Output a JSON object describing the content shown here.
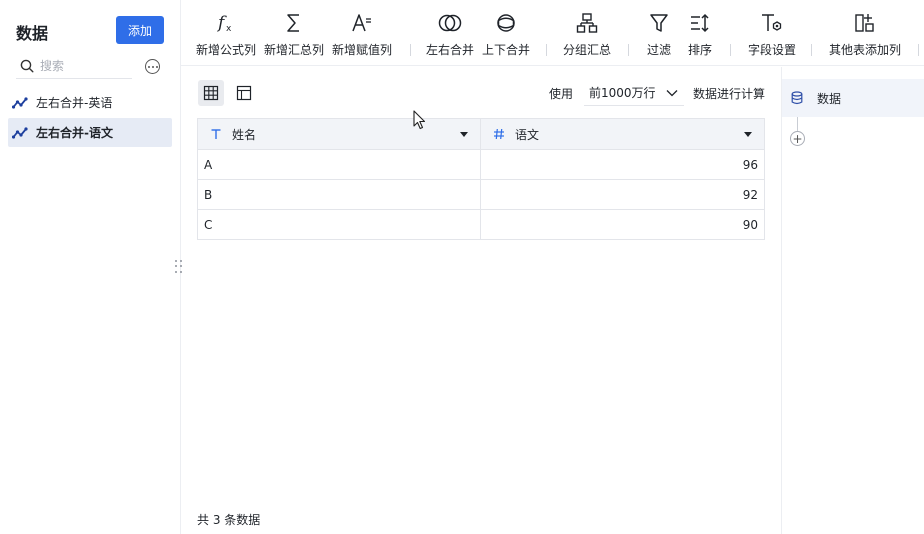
{
  "sidebar": {
    "title": "数据",
    "add_label": "添加",
    "search_placeholder": "搜索",
    "items": [
      {
        "label": "左右合并-英语",
        "active": false
      },
      {
        "label": "左右合并-语文",
        "active": true
      }
    ]
  },
  "toolbar": {
    "buttons": [
      {
        "label": "新增公式列",
        "icon": "formula-icon"
      },
      {
        "label": "新增汇总列",
        "icon": "sigma-icon"
      },
      {
        "label": "新增赋值列",
        "icon": "assign-icon"
      },
      {
        "label": "左右合并",
        "icon": "venn-icon"
      },
      {
        "label": "上下合并",
        "icon": "vertical-merge-icon"
      },
      {
        "label": "分组汇总",
        "icon": "group-icon"
      },
      {
        "label": "过滤",
        "icon": "filter-icon"
      },
      {
        "label": "排序",
        "icon": "sort-icon"
      },
      {
        "label": "字段设置",
        "icon": "field-settings-icon"
      },
      {
        "label": "其他表添加列",
        "icon": "add-column-icon"
      }
    ]
  },
  "controls": {
    "use_label": "使用",
    "rows_value": "前1000万行",
    "calc_label": "数据进行计算"
  },
  "table": {
    "columns": [
      {
        "name": "姓名",
        "type_icon": "text-type-icon"
      },
      {
        "name": "语文",
        "type_icon": "number-type-icon"
      }
    ],
    "rows": [
      [
        "A",
        "96"
      ],
      [
        "B",
        "92"
      ],
      [
        "C",
        "90"
      ]
    ]
  },
  "footer": {
    "count_text": "共 3 条数据"
  },
  "right_panel": {
    "node_label": "数据",
    "add_symbol": "+"
  },
  "colors": {
    "accent": "#2f6ee8",
    "active_bg": "#e6ebf5",
    "header_bg": "#f2f4f8",
    "line_icon": "#1d3f9e"
  }
}
